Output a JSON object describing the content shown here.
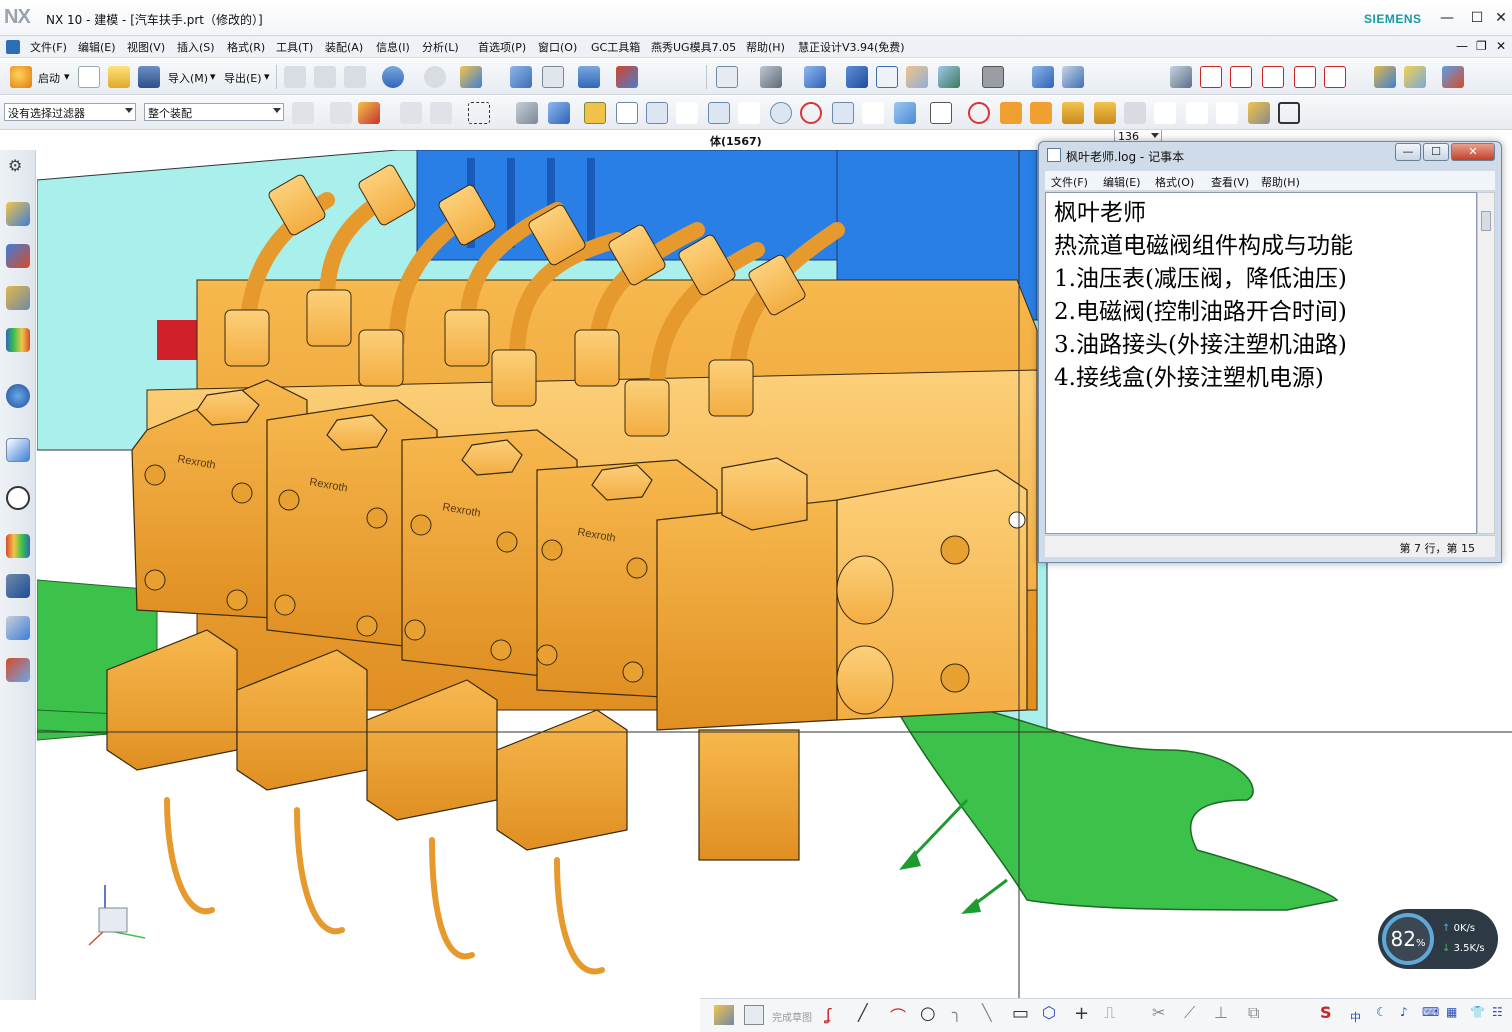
{
  "titlebar": {
    "logo": "NX",
    "title": "NX 10 - 建模 - [汽车扶手.prt（修改的）]",
    "brand": "SIEMENS"
  },
  "menu": {
    "items": [
      "文件(F)",
      "编辑(E)",
      "视图(V)",
      "插入(S)",
      "格式(R)",
      "工具(T)",
      "装配(A)",
      "信息(I)",
      "分析(L)",
      "首选项(P)",
      "窗口(O)",
      "GC工具箱",
      "燕秀UG模具7.05",
      "帮助(H)",
      "慧正设计V3.94(免费)"
    ]
  },
  "toolbar1": {
    "start_label": "启动",
    "import_label": "导入(M)",
    "export_label": "导出(E)",
    "zoom_value": "136"
  },
  "toolbar2": {
    "filter_value": "没有选择过滤器",
    "scope_value": "整个装配"
  },
  "viewport": {
    "object_label": "体(1567)",
    "brand_markings": [
      "Rexroth",
      "Rexroth",
      "Rexroth",
      "Rexroth"
    ]
  },
  "notepad": {
    "title": "枫叶老师.log - 记事本",
    "menu": [
      "文件(F)",
      "编辑(E)",
      "格式(O)",
      "查看(V)",
      "帮助(H)"
    ],
    "lines": [
      "枫叶老师",
      "",
      "热流道电磁阀组件构成与功能",
      "1.油压表(减压阀，降低油压)",
      "2.电磁阀(控制油路开合时间)",
      "3.油路接头(外接注塑机油路)",
      "4.接线盒(外接注塑机电源)"
    ],
    "status": "第 7 行，第 15"
  },
  "speed_widget": {
    "percent": "82",
    "percent_unit": "%",
    "up_value": "0",
    "up_unit": "K/s",
    "down_value": "3.5",
    "down_unit": "K/s"
  },
  "bottom_toolbar": {
    "finish_sketch_label": "完成草图"
  },
  "colors": {
    "part_orange": "#f2a43a",
    "part_green": "#3cc24a",
    "mold_cyan": "#a8f0ec",
    "mold_blue": "#2a7fe6",
    "accent": "#1a9aa8"
  }
}
